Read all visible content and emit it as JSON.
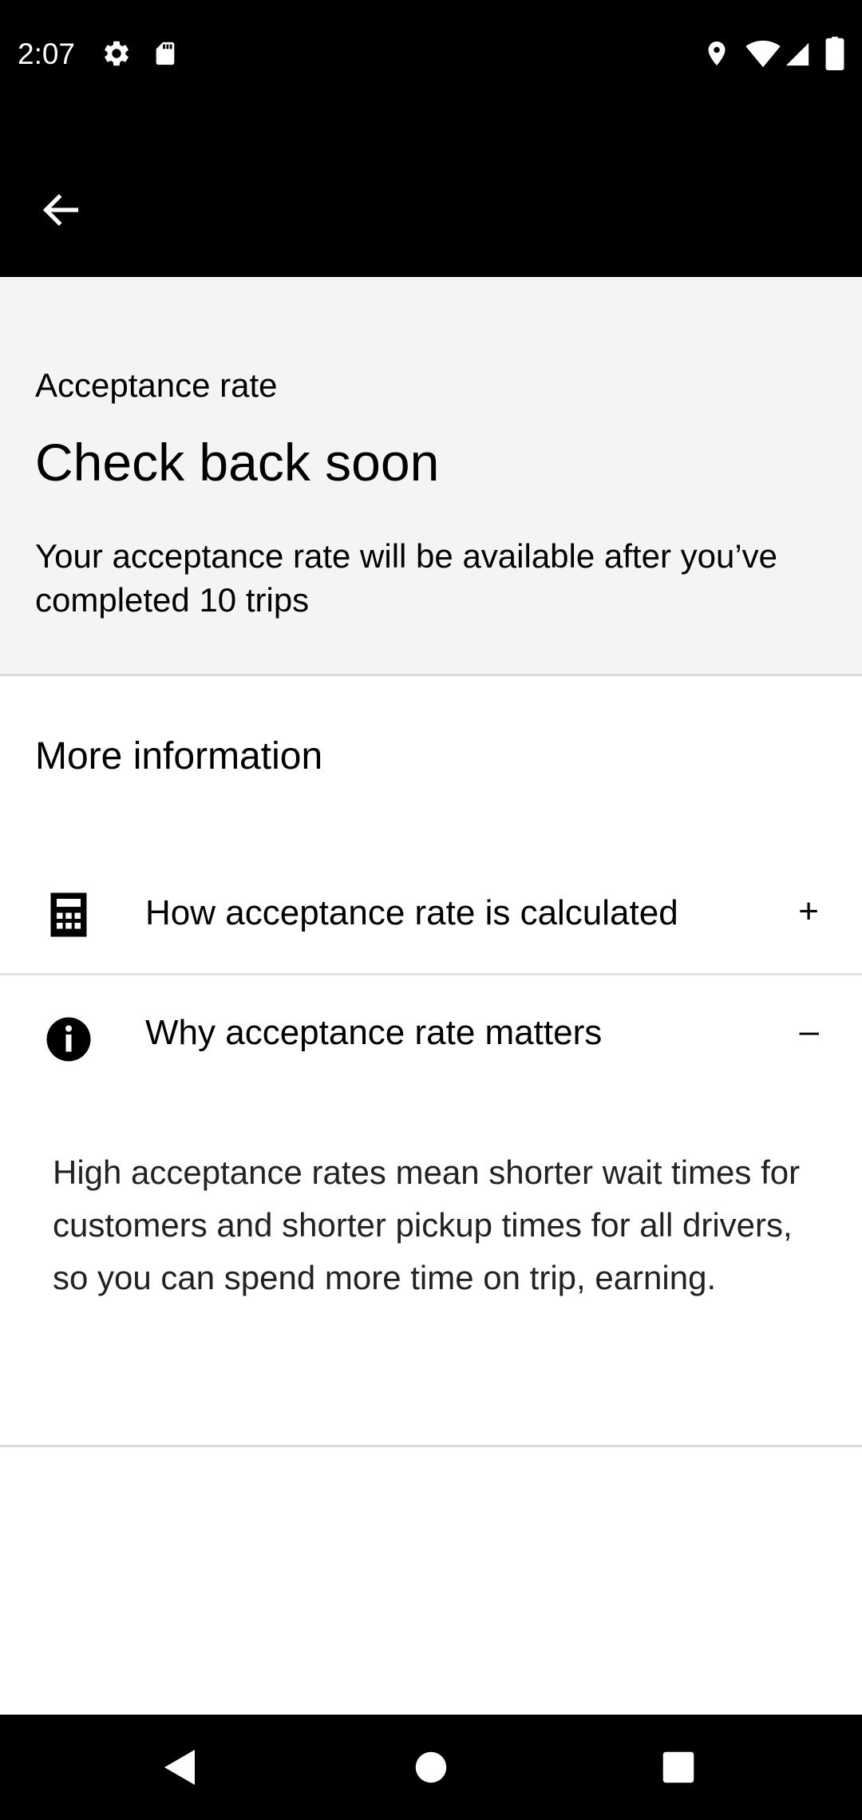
{
  "status_bar": {
    "time": "2:07",
    "left_icons": [
      "settings-icon",
      "sd-card-icon"
    ],
    "right_icons": [
      "location-icon",
      "wifi-icon",
      "cellular-signal-icon",
      "battery-icon"
    ]
  },
  "app_bar": {
    "back_icon": "arrow-left-icon"
  },
  "summary": {
    "label": "Acceptance rate",
    "title": "Check back soon",
    "description": "Your acceptance rate will be available after you’ve completed 10 trips"
  },
  "more_info": {
    "title": "More information",
    "items": [
      {
        "icon": "calculator-icon",
        "label": "How acceptance rate is calculated",
        "toggle": "+",
        "expanded": false
      },
      {
        "icon": "info-icon",
        "label": "Why acceptance rate matters",
        "toggle": "–",
        "expanded": true,
        "body": "High acceptance rates mean shorter wait times for customers and shorter pickup times for all drivers, so you can spend more time on trip, earning."
      }
    ]
  },
  "nav_bar": {
    "buttons": [
      "back-triangle-icon",
      "home-circle-icon",
      "recents-square-icon"
    ]
  },
  "colors": {
    "header_background": "#000000",
    "summary_background": "#f4f4f4",
    "divider": "#d9d9d9",
    "text": "#000000"
  }
}
